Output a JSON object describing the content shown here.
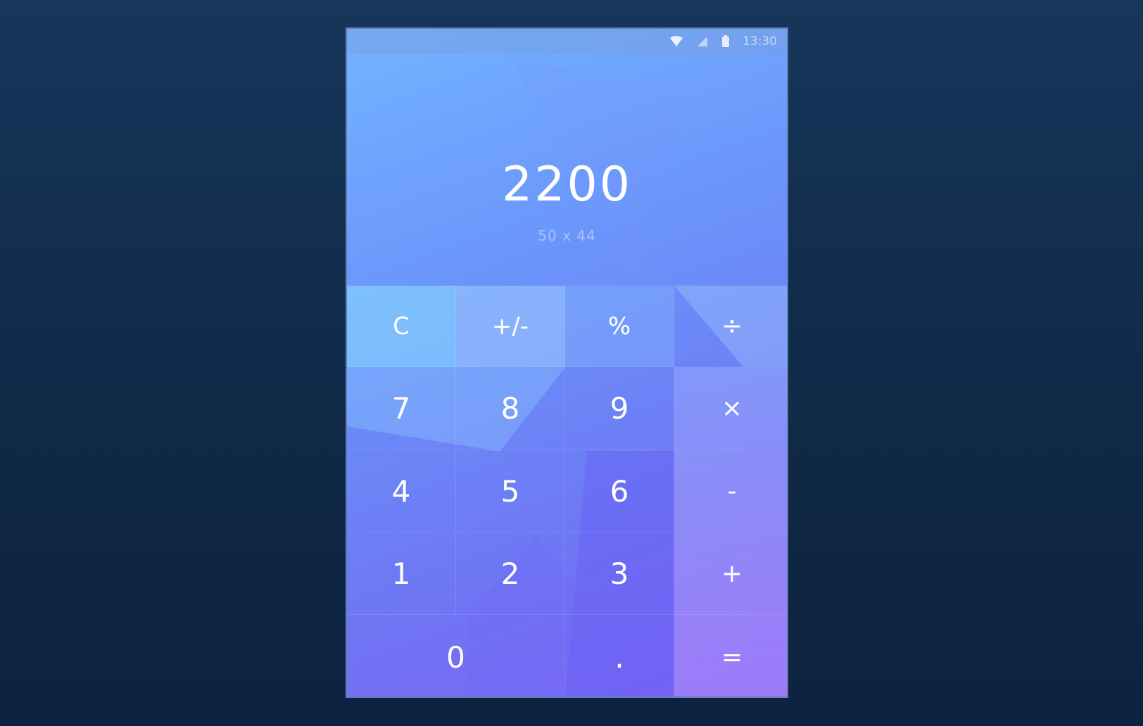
{
  "status_bar": {
    "icons": [
      "wifi-icon",
      "signal-icon",
      "battery-icon"
    ],
    "time": "13:30"
  },
  "display": {
    "result": "2200",
    "expression": "50 x 44"
  },
  "keypad": {
    "clear": "C",
    "sign": "+/-",
    "percent": "%",
    "divide": "÷",
    "seven": "7",
    "eight": "8",
    "nine": "9",
    "multiply": "×",
    "four": "4",
    "five": "5",
    "six": "6",
    "subtract": "-",
    "one": "1",
    "two": "2",
    "three": "3",
    "add": "+",
    "zero": "0",
    "decimal": ".",
    "equals": "="
  },
  "colors": {
    "page_background": "#122f50",
    "gradient_top": "#72b4ff",
    "gradient_bottom": "#7d63f5",
    "key_text": "#ffffff"
  }
}
